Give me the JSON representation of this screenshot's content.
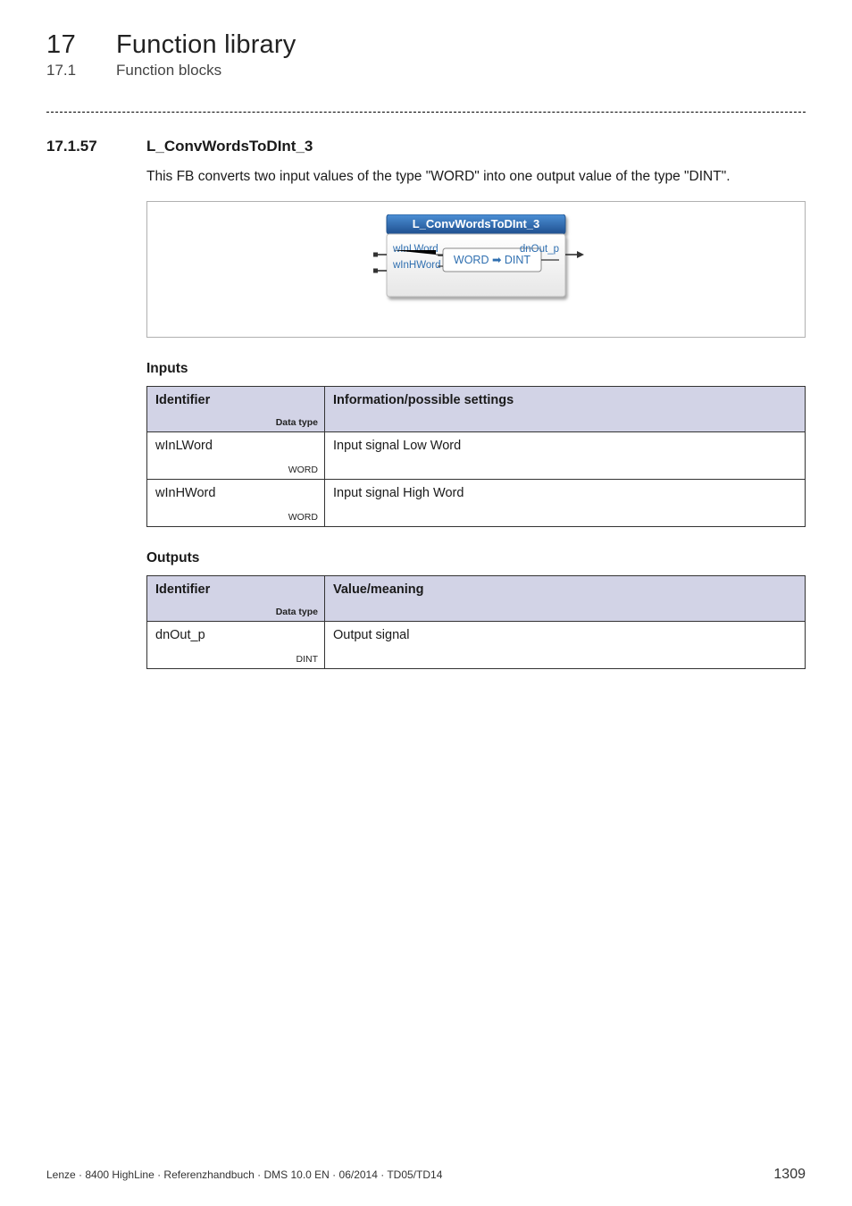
{
  "chapter_num": "17",
  "chapter_title": "Function library",
  "section_num": "17.1",
  "section_title": "Function blocks",
  "heading_num": "17.1.57",
  "heading_title": "L_ConvWordsToDInt_3",
  "intro": "This FB converts two input values of the type \"WORD\" into one output value of the type \"DINT\".",
  "diagram": {
    "block_name": "L_ConvWordsToDInt_3",
    "in1": "wInLWord",
    "in2": "wInHWord",
    "inner": "WORD ➡ DINT",
    "out": "dnOut_p"
  },
  "inputs": {
    "heading": "Inputs",
    "col_id": "Identifier",
    "col_dtype_label": "Data type",
    "col_desc": "Information/possible settings",
    "rows": [
      {
        "id": "wInLWord",
        "dtype": "WORD",
        "desc": "Input signal Low Word"
      },
      {
        "id": "wInHWord",
        "dtype": "WORD",
        "desc": "Input signal High Word"
      }
    ]
  },
  "outputs": {
    "heading": "Outputs",
    "col_id": "Identifier",
    "col_dtype_label": "Data type",
    "col_desc": "Value/meaning",
    "rows": [
      {
        "id": "dnOut_p",
        "dtype": "DINT",
        "desc": "Output signal"
      }
    ]
  },
  "footer_left": "Lenze · 8400 HighLine · Referenzhandbuch · DMS 10.0 EN · 06/2014 · TD05/TD14",
  "footer_page": "1309"
}
